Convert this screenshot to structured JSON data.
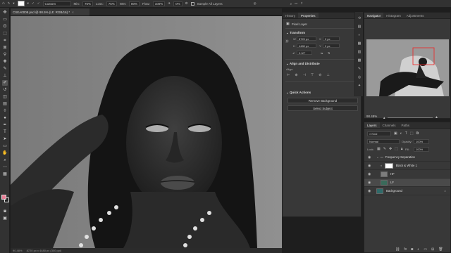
{
  "options_bar": {
    "mode_value": "Custom",
    "min_label": "Min:",
    "min_value": "75%",
    "loss_label": "Loss:",
    "loss_value": "75%",
    "wet_label": "Wet:",
    "wet_value": "80%",
    "flow_label": "Flow:",
    "flow_value": "100%",
    "smoothing_value": "0%",
    "sample_all_layers": "Sample All Layers"
  },
  "document": {
    "tab_title": "CSEA0008.psd @ 90.5% (LF, RGB/16) *",
    "zoom": "90.48%",
    "doc_info": "8720 px x 4480 px (300 ppi)"
  },
  "properties": {
    "tabs": [
      "History",
      "Properties"
    ],
    "selected_tab": "Properties",
    "layer_kind": "Pixel Layer",
    "transform_title": "Transform",
    "w_label": "W",
    "w_value": "8720 px",
    "x_label": "X",
    "x_value": "0 px",
    "h_label": "H",
    "h_value": "4480 px",
    "y_label": "Y",
    "y_value": "0 px",
    "angle_value": "0.00°",
    "align_title": "Align and Distribute",
    "align_label": "Align:",
    "quick_actions_title": "Quick Actions",
    "remove_bg_label": "Remove Background",
    "select_subject_label": "Select Subject"
  },
  "navigator": {
    "tabs": [
      "Navigator",
      "Histogram",
      "Adjustments"
    ],
    "zoom": "90.48%"
  },
  "layers": {
    "tabs": [
      "Layers",
      "Channels",
      "Paths"
    ],
    "filter_kind": "Kind",
    "blend_mode": "Normal",
    "opacity_label": "Opacity:",
    "opacity_value": "100%",
    "lock_label": "Lock:",
    "fill_label": "Fill:",
    "fill_value": "100%",
    "rows": [
      {
        "name": "Frequency Separation"
      },
      {
        "name": "Black & White 1"
      },
      {
        "name": "HF"
      },
      {
        "name": "LF"
      },
      {
        "name": "Background"
      }
    ]
  },
  "colors": {
    "foreground": "#e87d95",
    "background": "#222222",
    "accent": "#2f7bd8"
  }
}
